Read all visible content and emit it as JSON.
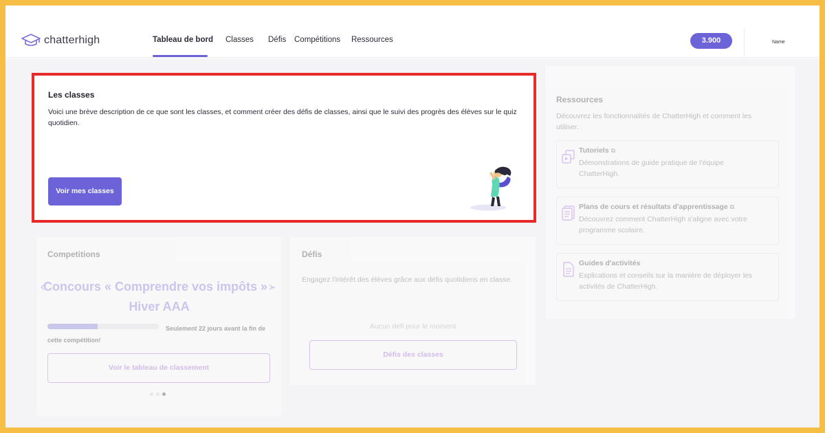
{
  "app": {
    "brand": "chatterhigh"
  },
  "nav": {
    "items": [
      {
        "label": "Tableau de bord",
        "active": true
      },
      {
        "label": "Classes",
        "active": false
      },
      {
        "label": "Défis",
        "active": false
      },
      {
        "label": "Compétitions",
        "active": false
      },
      {
        "label": "Ressources",
        "active": false
      }
    ],
    "points": "3.900",
    "username": "Name"
  },
  "classes_card": {
    "title": "Les classes",
    "description": "Voici une brève description de ce que sont les classes, et comment créer des défis de classes, ainsi que le suivi des progrès des élèves sur le quiz quotidien.",
    "button_label": "Voir mes classes"
  },
  "resources": {
    "title": "Ressources",
    "subtitle": "Découvrez les fonctionnalités de ChatterHigh et comment les utiliser.",
    "items": [
      {
        "title": "Tutoriels",
        "description": "Démonstrations de guide pratique de l'équipe ChatterHigh.",
        "icon": "video-tutorial-icon",
        "external": true
      },
      {
        "title": "Plans de cours et résultats d'apprentissage",
        "description": "Découvrez comment ChatterHigh s'aligne avec votre programme scolaire.",
        "icon": "lesson-plan-icon",
        "external": true
      },
      {
        "title": "Guides d'activités",
        "description": "Explications et conseils sur la manière de déployer les activités de ChatterHigh.",
        "icon": "document-icon",
        "external": false
      }
    ]
  },
  "competitions": {
    "title": "Competitions",
    "current_name": "Concours « Comprendre vos impôts » - Hiver AAA",
    "progress": 0.45,
    "remaining_text": "Seulement 22 jours avant la fin de cette compétition!",
    "button_label": "Voir le tableau de classement",
    "carousel_active_index": 2
  },
  "defis": {
    "title": "Défis",
    "subtitle": "Engagez l'intérêt des élèves grâce aux défis quotidiens en classe.",
    "empty_text": "Aucun défi pour le moment",
    "button_label": "Défis des classes"
  },
  "colors": {
    "accent": "#6c63d9",
    "highlight": "#e62a2a",
    "frame": "#f7be46"
  }
}
